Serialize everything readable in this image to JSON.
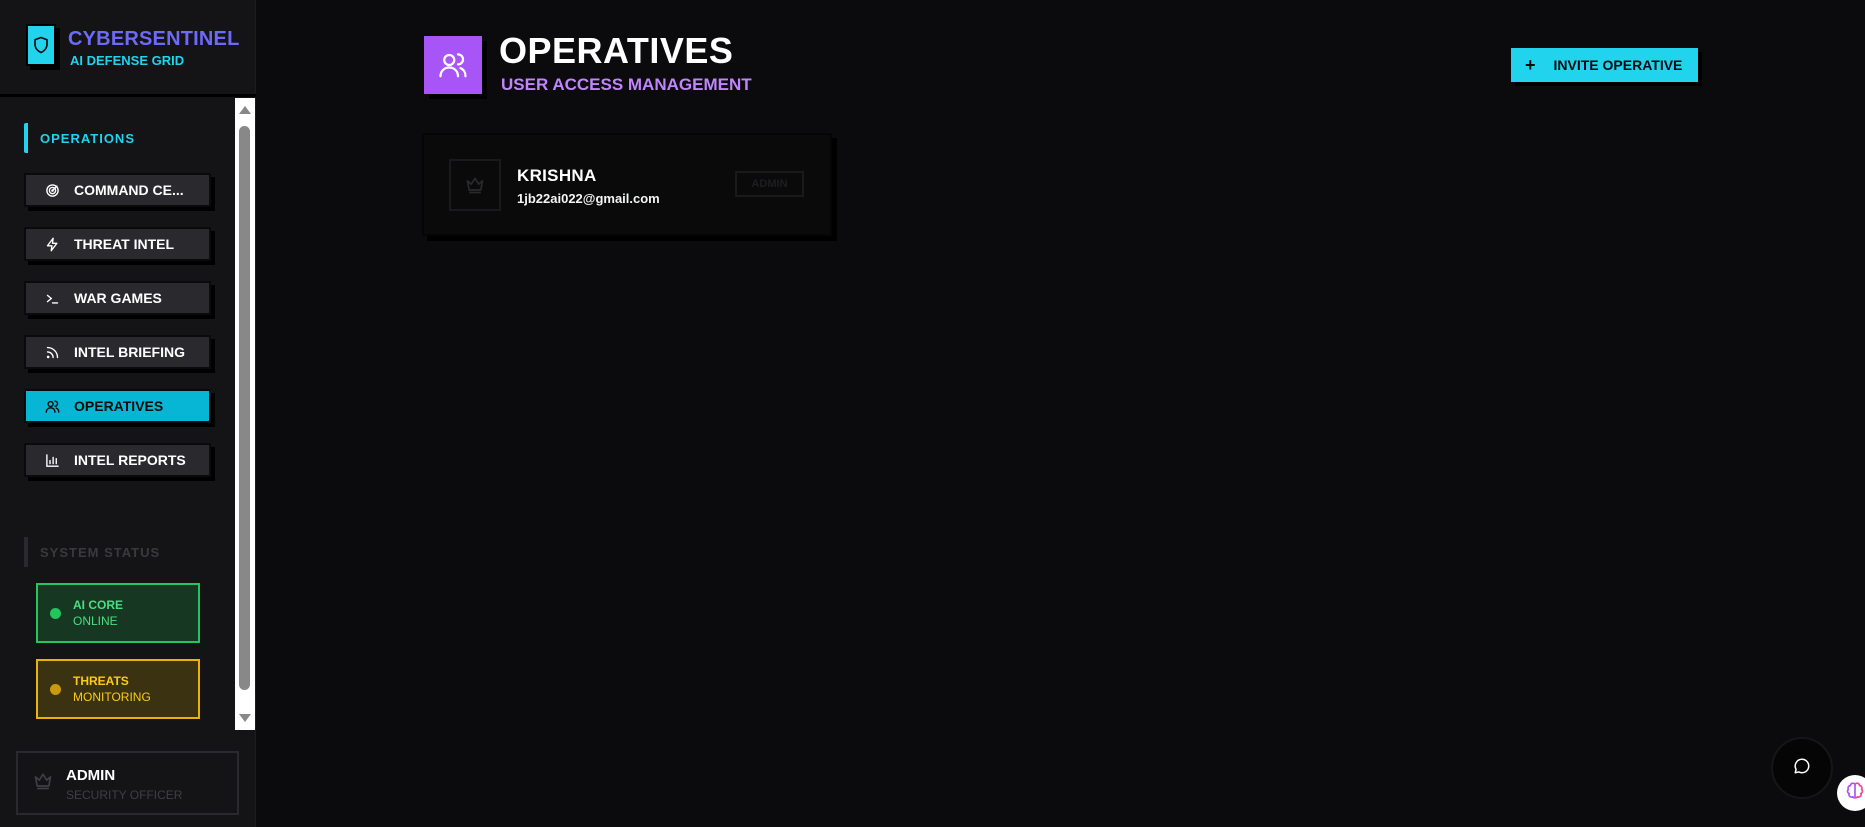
{
  "brand": {
    "title": "CYBERSENTINEL",
    "subtitle": "AI DEFENSE GRID",
    "logo_icon": "shield-icon"
  },
  "sidebar": {
    "section_label": "OPERATIONS",
    "items": [
      {
        "label": "COMMAND CE...",
        "icon": "radar-icon",
        "active": false
      },
      {
        "label": "THREAT INTEL",
        "icon": "zap-icon",
        "active": false
      },
      {
        "label": "WAR GAMES",
        "icon": "terminal-icon",
        "active": false
      },
      {
        "label": "INTEL BRIEFING",
        "icon": "rss-icon",
        "active": false
      },
      {
        "label": "OPERATIVES",
        "icon": "users-icon",
        "active": true
      },
      {
        "label": "INTEL REPORTS",
        "icon": "bar-chart-icon",
        "active": false
      }
    ],
    "status_label": "SYSTEM STATUS",
    "status_cards": [
      {
        "line1": "AI CORE",
        "line2": "ONLINE",
        "color": "#22c55e"
      },
      {
        "line1": "THREATS",
        "line2": "MONITORING",
        "color": "#eab308"
      }
    ]
  },
  "user": {
    "name": "ADMIN",
    "role": "SECURITY OFFICER",
    "icon": "crown-icon"
  },
  "header": {
    "title": "OPERATIVES",
    "subtitle": "USER ACCESS MANAGEMENT",
    "icon": "users-icon"
  },
  "actions": {
    "invite_label": "INVITE OPERATIVE",
    "invite_icon": "plus-icon"
  },
  "operatives": [
    {
      "name": "KRISHNA",
      "email": "1jb22ai022@gmail.com",
      "badge": "ADMIN",
      "icon": "crown-icon"
    }
  ],
  "floating": {
    "chat_icon": "chat-bubble-icon",
    "assistant_icon": "brain-icon"
  },
  "colors": {
    "accent": "#22d3ee",
    "brand": "#6d6af5",
    "purple": "#a855f7",
    "success": "#22c55e",
    "warning": "#eab308",
    "background": "#0b0b0d"
  }
}
